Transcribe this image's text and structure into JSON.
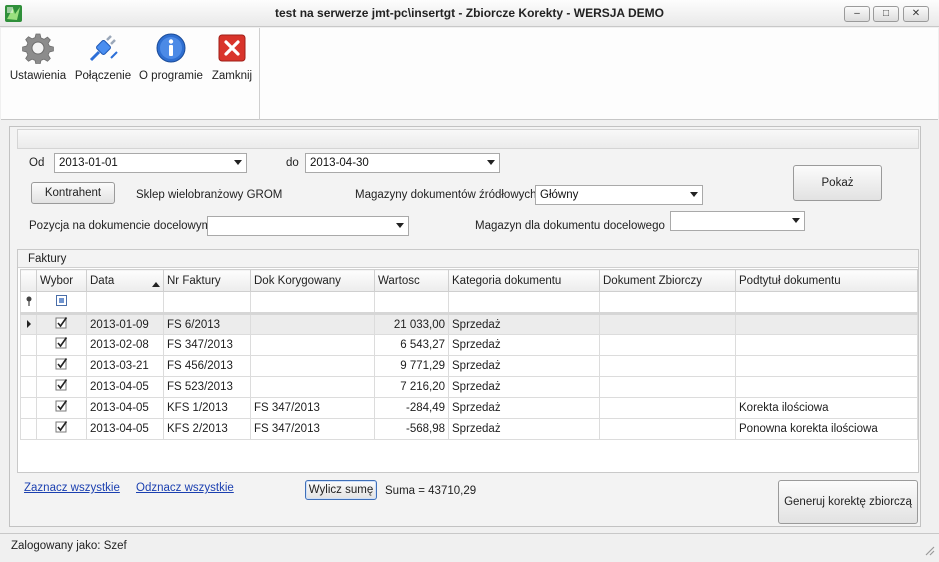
{
  "window": {
    "title": "test na serwerze jmt-pc\\insertgt - Zbiorcze Korekty - WERSJA DEMO",
    "minimize": "–",
    "maximize": "□",
    "close": "✕"
  },
  "toolbar": {
    "items": [
      {
        "label": "Ustawienia",
        "icon": "gear-icon"
      },
      {
        "label": "Połączenie",
        "icon": "plug-icon"
      },
      {
        "label": "O programie",
        "icon": "info-icon"
      },
      {
        "label": "Zamknij",
        "icon": "close-red-icon"
      }
    ]
  },
  "filters": {
    "from_label": "Od",
    "from_value": "2013-01-01",
    "to_label": "do",
    "to_value": "2013-04-30",
    "contractor_button": "Kontrahent",
    "contractor_value": "Sklep wielobranżowy GROM",
    "source_warehouses_label": "Magazyny dokumentów źródłowych",
    "source_warehouses_value": "Główny",
    "target_position_label": "Pozycja na dokumencie docelowym",
    "target_position_value": "",
    "target_warehouse_label": "Magazyn dla dokumentu docelowego",
    "target_warehouse_value": "",
    "show_button": "Pokaż"
  },
  "invoices": {
    "group_title": "Faktury",
    "columns": [
      "Wybor",
      "Data",
      "Nr Faktury",
      "Dok Korygowany",
      "Wartosc",
      "Kategoria dokumentu",
      "Dokument Zbiorczy",
      "Podtytuł dokumentu"
    ],
    "rows": [
      {
        "checked": true,
        "date": "2013-01-09",
        "number": "FS 6/2013",
        "corrected": "",
        "value": "21 033,00",
        "category": "Sprzedaż",
        "collective": "",
        "subtitle": ""
      },
      {
        "checked": true,
        "date": "2013-02-08",
        "number": "FS 347/2013",
        "corrected": "",
        "value": "6 543,27",
        "category": "Sprzedaż",
        "collective": "",
        "subtitle": ""
      },
      {
        "checked": true,
        "date": "2013-03-21",
        "number": "FS 456/2013",
        "corrected": "",
        "value": "9 771,29",
        "category": "Sprzedaż",
        "collective": "",
        "subtitle": ""
      },
      {
        "checked": true,
        "date": "2013-04-05",
        "number": "FS 523/2013",
        "corrected": "",
        "value": "7 216,20",
        "category": "Sprzedaż",
        "collective": "",
        "subtitle": ""
      },
      {
        "checked": true,
        "date": "2013-04-05",
        "number": "KFS 1/2013",
        "corrected": "FS 347/2013",
        "value": "-284,49",
        "category": "Sprzedaż",
        "collective": "",
        "subtitle": "Korekta ilościowa"
      },
      {
        "checked": true,
        "date": "2013-04-05",
        "number": "KFS 2/2013",
        "corrected": "FS 347/2013",
        "value": "-568,98",
        "category": "Sprzedaż",
        "collective": "",
        "subtitle": "Ponowna korekta ilościowa"
      }
    ]
  },
  "actions": {
    "select_all": "Zaznacz wszystkie",
    "deselect_all": "Odznacz wszystkie",
    "calc_sum": "Wylicz sumę",
    "sum_text": "Suma = 43710,29",
    "generate": "Generuj korektę zbiorczą"
  },
  "status": {
    "logged_in": "Zalogowany jako: Szef"
  },
  "colors": {
    "link": "#1a3fb0",
    "close_red": "#d9342b",
    "info_blue": "#2f6fd1"
  }
}
